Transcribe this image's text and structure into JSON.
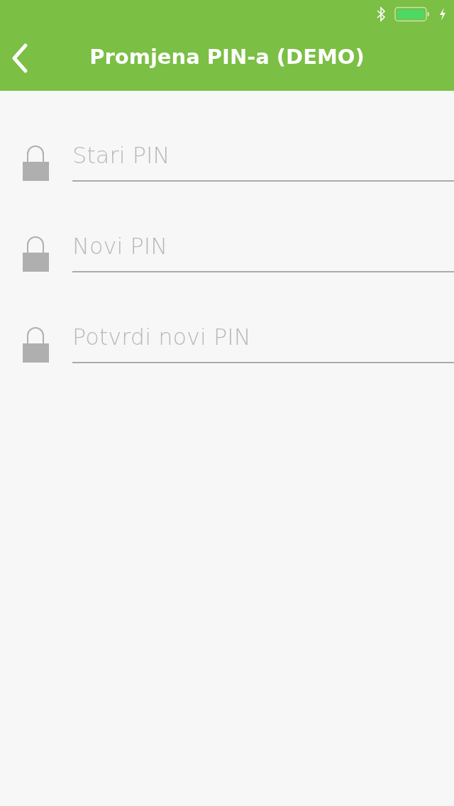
{
  "nav_bar": {
    "title": "Promjena PIN-a (DEMO)"
  },
  "fields": [
    {
      "placeholder": "Stari PIN"
    },
    {
      "placeholder": "Novi PIN"
    },
    {
      "placeholder": "Potvrdi novi PIN"
    }
  ]
}
